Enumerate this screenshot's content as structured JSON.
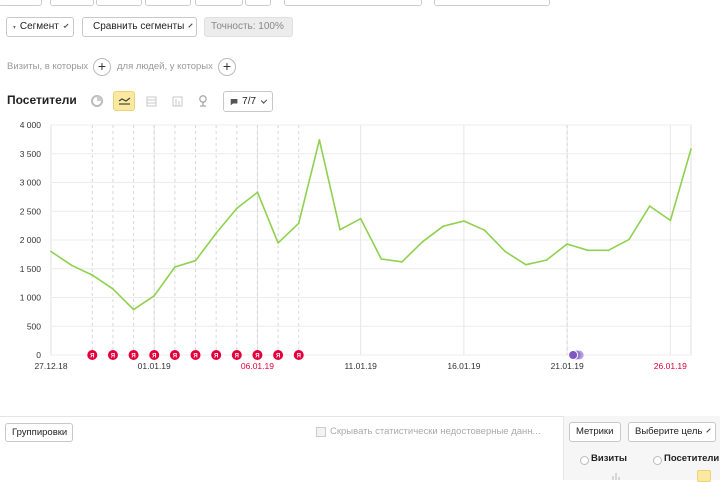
{
  "toolbar": {
    "segment_label": "Сегмент",
    "compare_label": "Сравнить сегменты",
    "accuracy_label": "Точность: 100%"
  },
  "conditions": {
    "visits_label": "Визиты, в которых",
    "people_label": "для людей, у которых"
  },
  "report": {
    "title": "Посетители",
    "annotations_label": "7/7"
  },
  "chart_data": {
    "type": "line",
    "series": [
      {
        "values": [
          1800,
          1560,
          1390,
          1150,
          790,
          1030,
          1530,
          1640,
          2120,
          2550,
          2830,
          1950,
          2290,
          3740,
          2180,
          2370,
          1670,
          1620,
          1970,
          2240,
          2330,
          2170,
          1800,
          1570,
          1650,
          1930,
          1820,
          1820,
          2010,
          2590,
          2340,
          3580
        ]
      }
    ],
    "x": [
      "27.12.18",
      "28.12.18",
      "29.12.18",
      "30.12.18",
      "31.12.18",
      "01.01.19",
      "02.01.19",
      "03.01.19",
      "04.01.19",
      "05.01.19",
      "06.01.19",
      "07.01.19",
      "08.01.19",
      "09.01.19",
      "10.01.19",
      "11.01.19",
      "12.01.19",
      "13.01.19",
      "14.01.19",
      "15.01.19",
      "16.01.19",
      "17.01.19",
      "18.01.19",
      "19.01.19",
      "20.01.19",
      "21.01.19",
      "22.01.19",
      "23.01.19",
      "24.01.19",
      "25.01.19",
      "26.01.19",
      "27.01.19"
    ],
    "xtick_labels": [
      "27.12.18",
      "01.01.19",
      "06.01.19",
      "11.01.19",
      "16.01.19",
      "21.01.19",
      "26.01.19"
    ],
    "yticks": [
      "0",
      "500",
      "1 000",
      "1 500",
      "2 000",
      "2 500",
      "3 000",
      "3 500",
      "4 000"
    ],
    "ylim": [
      0,
      4000
    ],
    "color": "#8fd14f",
    "holiday_color": "#e3003a",
    "grid": true
  },
  "bottom": {
    "groupings_label": "Группировки",
    "hide_label": "Скрывать статистически недостоверные данн...",
    "metrics_label": "Метрики",
    "goal_label": "Выберите цель",
    "col_visits": "Визиты",
    "col_visitors": "Посетители"
  }
}
